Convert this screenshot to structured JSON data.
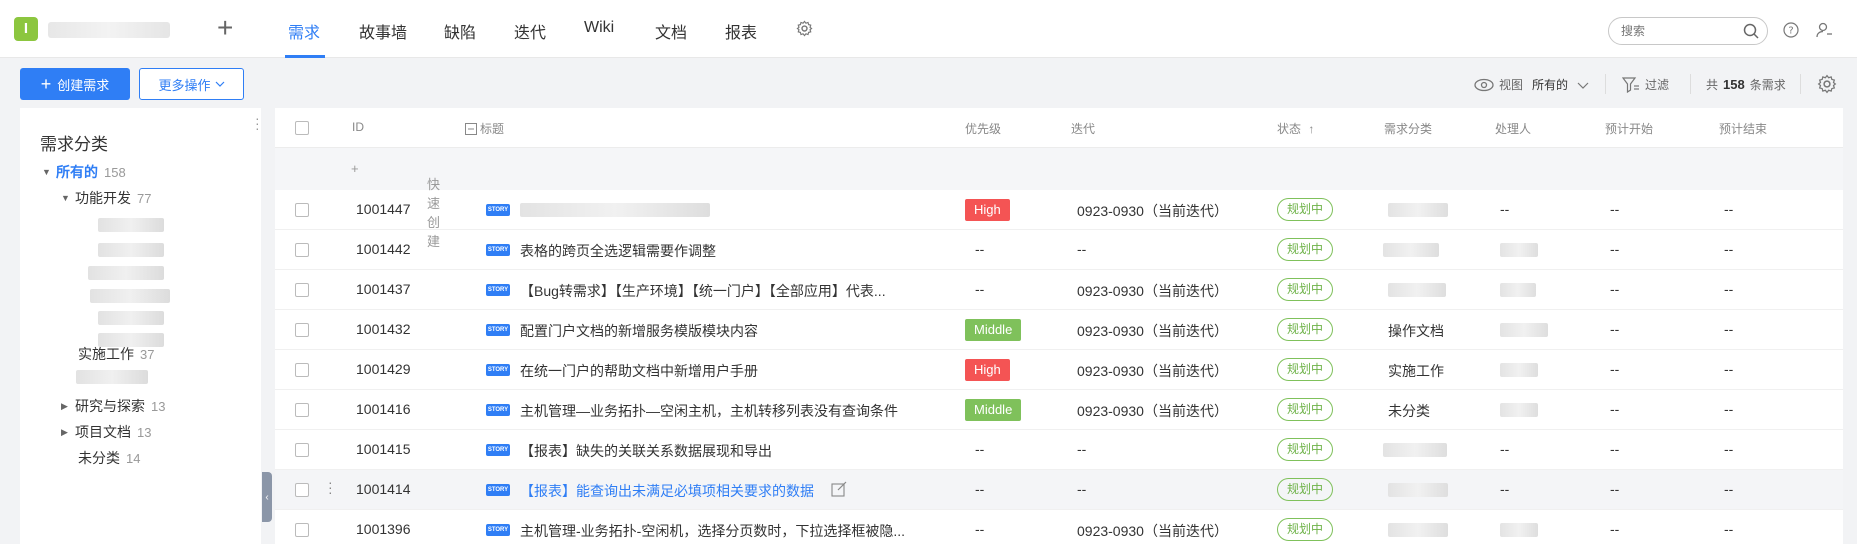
{
  "topbar": {
    "logo_letter": "I",
    "nav_tabs": [
      "需求",
      "故事墙",
      "缺陷",
      "迭代",
      "Wiki",
      "文档",
      "报表"
    ],
    "search_placeholder": "搜索"
  },
  "toolbar": {
    "create_label": "创建需求",
    "more_label": "更多操作",
    "view_label": "视图",
    "view_value": "所有的",
    "filter_label": "过滤",
    "count_prefix": "共",
    "count_value": "158",
    "count_suffix": "条需求"
  },
  "sidebar": {
    "title": "需求分类",
    "items": [
      {
        "label": "所有的",
        "count": "158"
      },
      {
        "label": "功能开发",
        "count": "77"
      },
      {
        "label": "实施工作",
        "count": "37"
      },
      {
        "label": "研究与探索",
        "count": "13"
      },
      {
        "label": "项目文档",
        "count": "13"
      },
      {
        "label": "未分类",
        "count": "14"
      }
    ]
  },
  "table": {
    "columns": [
      "ID",
      "标题",
      "优先级",
      "迭代",
      "状态",
      "需求分类",
      "处理人",
      "预计开始",
      "预计结束"
    ],
    "sort_arrow": "↑",
    "quick_create": "快速创建",
    "story_tag": "STORY",
    "rows": [
      {
        "id": "1001447",
        "title": "",
        "priority": "High",
        "iteration": "0923-0930（当前迭代）",
        "status": "规划中",
        "category": "",
        "owner": "",
        "start": "--",
        "end": "--"
      },
      {
        "id": "1001442",
        "title": "表格的跨页全选逻辑需要作调整",
        "priority": "--",
        "iteration": "--",
        "status": "规划中",
        "category": "",
        "owner": "",
        "start": "--",
        "end": "--"
      },
      {
        "id": "1001437",
        "title": "【Bug转需求】【生产环境】【统一门户】【全部应用】代表...",
        "priority": "--",
        "iteration": "0923-0930（当前迭代）",
        "status": "规划中",
        "category": "",
        "owner": "",
        "start": "--",
        "end": "--"
      },
      {
        "id": "1001432",
        "title": "配置门户文档的新增服务模版模块内容",
        "priority": "Middle",
        "iteration": "0923-0930（当前迭代）",
        "status": "规划中",
        "category": "操作文档",
        "owner": "",
        "start": "--",
        "end": "--"
      },
      {
        "id": "1001429",
        "title": "在统一门户的帮助文档中新增用户手册",
        "priority": "High",
        "iteration": "0923-0930（当前迭代）",
        "status": "规划中",
        "category": "实施工作",
        "owner": "",
        "start": "--",
        "end": "--"
      },
      {
        "id": "1001416",
        "title": "主机管理—业务拓扑—空闲主机，主机转移列表没有查询条件",
        "priority": "Middle",
        "iteration": "0923-0930（当前迭代）",
        "status": "规划中",
        "category": "未分类",
        "owner": "",
        "start": "--",
        "end": "--"
      },
      {
        "id": "1001415",
        "title": "【报表】缺失的关联关系数据展现和导出",
        "priority": "--",
        "iteration": "--",
        "status": "规划中",
        "category": "",
        "owner": "--",
        "start": "--",
        "end": "--"
      },
      {
        "id": "1001414",
        "title": "【报表】能查询出未满足必填项相关要求的数据",
        "priority": "--",
        "iteration": "--",
        "status": "规划中",
        "category": "",
        "owner": "--",
        "start": "--",
        "end": "--"
      },
      {
        "id": "1001396",
        "title": "主机管理-业务拓扑-空闲机，选择分页数时，下拉选择框被隐...",
        "priority": "--",
        "iteration": "0923-0930（当前迭代）",
        "status": "规划中",
        "category": "",
        "owner": "",
        "start": "--",
        "end": "--"
      }
    ]
  },
  "colors": {
    "accent": "#2f7ef5",
    "high": "#f45454",
    "middle": "#7fc15b",
    "status": "#6db247"
  }
}
